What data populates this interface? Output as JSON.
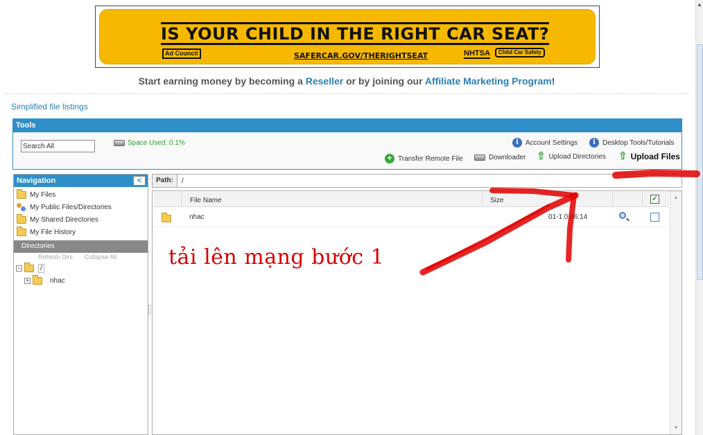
{
  "banner": {
    "headline": "IS YOUR CHILD IN THE RIGHT CAR SEAT?",
    "adcouncil": "Ad Council",
    "url": "SAFERCAR.GOV/THERIGHTSEAT",
    "nhtsa": "NHTSA",
    "childcar": "Child Car Safety"
  },
  "promo": {
    "prefix": "Start earning money by becoming a ",
    "reseller": "Reseller",
    "middle": " or by joining our ",
    "affiliate": "Affiliate Marketing Program",
    "suffix": "!"
  },
  "simplified_link": "Simplified file listings",
  "tools": {
    "title": "Tools",
    "search_value": "Search All",
    "space_used": "Space Used: 0.1%",
    "account_settings": "Account Settings",
    "desktop_tools": "Desktop Tools/Tutorials",
    "transfer_remote": "Transfer Remote File",
    "downloader": "Downloader",
    "upload_directories": "Upload Directories",
    "upload_files": "Upload Files"
  },
  "navigation": {
    "title": "Navigation",
    "collapse_glyph": "<",
    "items": [
      {
        "label": "My Files"
      },
      {
        "label": "My Public Files/Directories"
      },
      {
        "label": "My Shared Directories"
      },
      {
        "label": "My File History"
      }
    ],
    "directories_title": "Directories",
    "refresh_dirs": "Refresh Dirs",
    "collapse_all": "Collapse All",
    "root_label": "/",
    "child_label": "nhac",
    "collapse_toggle": "−",
    "expand_toggle": "+"
  },
  "path": {
    "label": "Path:",
    "value": "/"
  },
  "file_table": {
    "col_name": "File Name",
    "col_size": "Size",
    "check_all_glyph": "✓",
    "rows": [
      {
        "name": "nhac",
        "date": "01-1  0:06:14"
      }
    ]
  },
  "annotation": {
    "text": "tải lên mạng bước 1",
    "color": "#d40000"
  },
  "colors": {
    "accent": "#2e8fc8",
    "link": "#2a7fb4",
    "banner_yellow": "#f6b800"
  }
}
